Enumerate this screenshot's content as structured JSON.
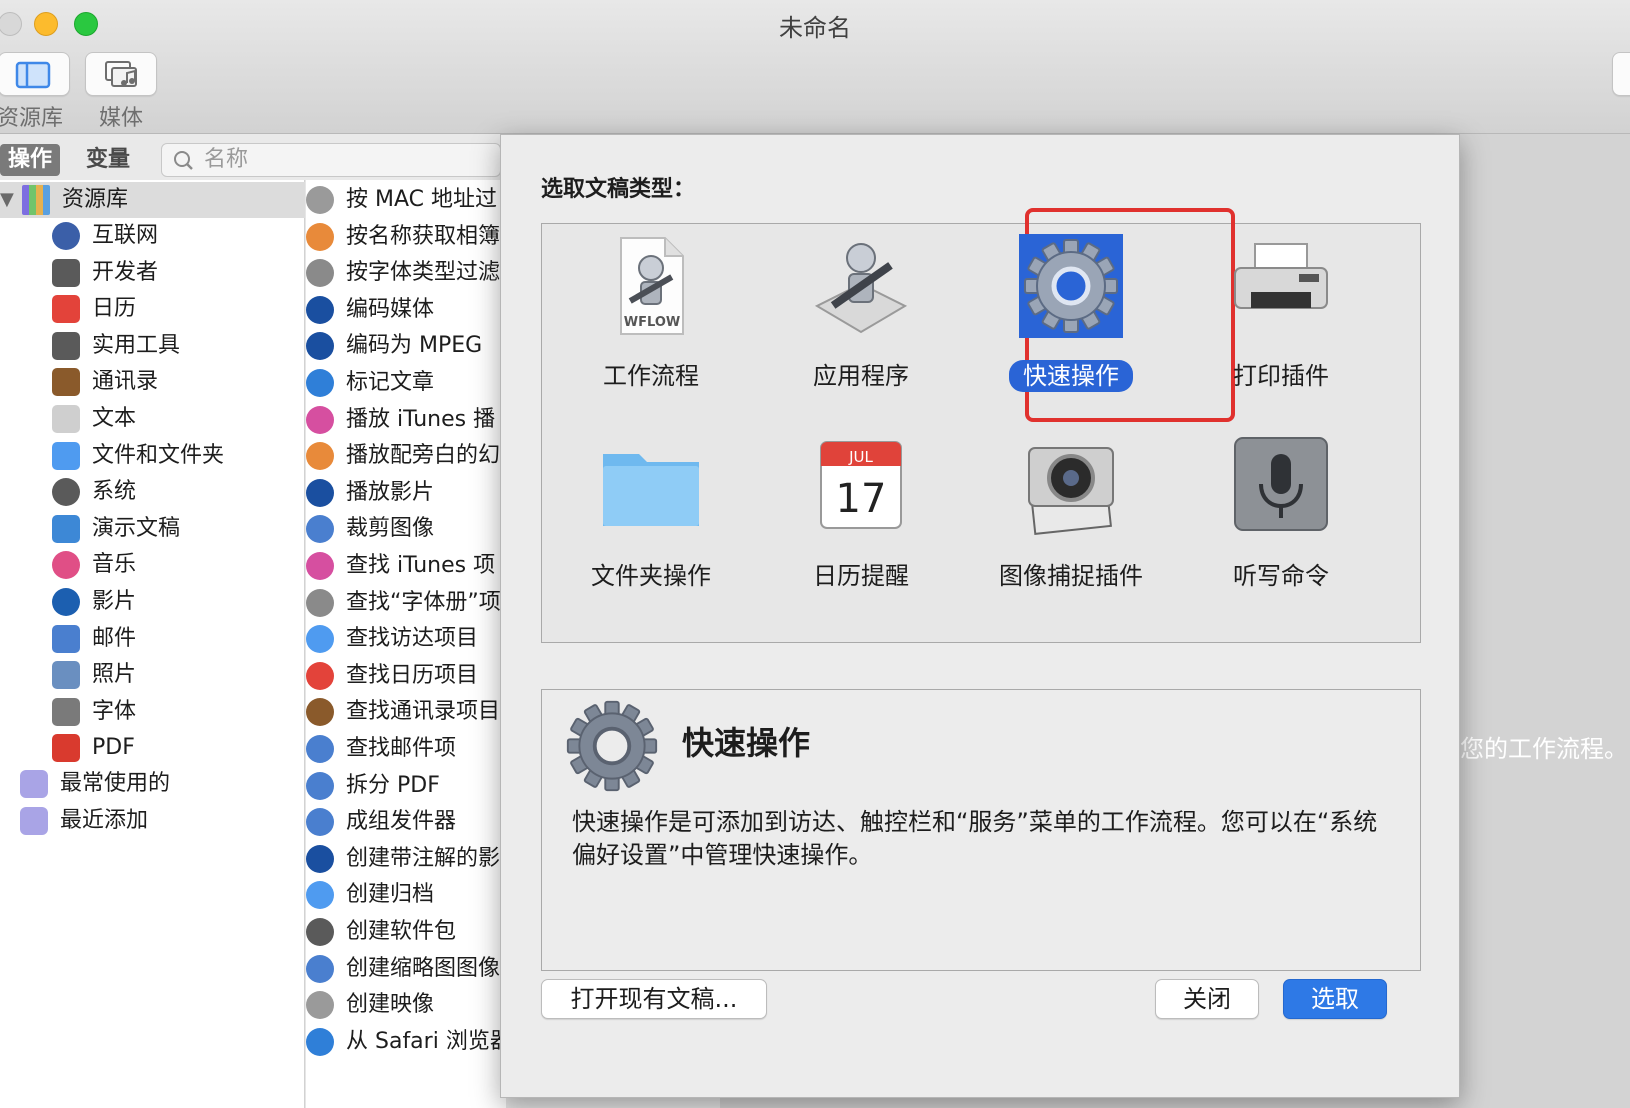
{
  "window": {
    "title": "未命名",
    "toolbar": {
      "library_label": "资源库",
      "media_label": "媒体"
    }
  },
  "sidebar": {
    "tabs": {
      "actions": "操作",
      "variables": "变量"
    },
    "search_placeholder": "名称",
    "library_root": "资源库",
    "library_items": [
      "互联网",
      "开发者",
      "日历",
      "实用工具",
      "通讯录",
      "文本",
      "文件和文件夹",
      "系统",
      "演示文稿",
      "音乐",
      "影片",
      "邮件",
      "照片",
      "字体",
      "PDF"
    ],
    "smart_groups": [
      "最常使用的",
      "最近添加"
    ]
  },
  "actions_list": [
    "按 MAC 地址过",
    "按名称获取相簿",
    "按字体类型过滤",
    "编码媒体",
    "编码为 MPEG",
    "标记文章",
    "播放 iTunes 播",
    "播放配旁白的幻",
    "播放影片",
    "裁剪图像",
    "查找 iTunes 项",
    "查找“字体册”项",
    "查找访达项目",
    "查找日历项目",
    "查找通讯录项目",
    "查找邮件项",
    "拆分 PDF",
    "成组发件器",
    "创建带注解的影",
    "创建归档",
    "创建软件包",
    "创建缩略图图像",
    "创建映像",
    "从 Safari 浏览器"
  ],
  "workflow_hint": "您的工作流程。",
  "sheet": {
    "title": "选取文稿类型：",
    "types": [
      {
        "label": "工作流程",
        "icon": "workflow-icon",
        "badge": "WFLOW"
      },
      {
        "label": "应用程序",
        "icon": "application-icon"
      },
      {
        "label": "快速操作",
        "icon": "gear-icon",
        "selected": true
      },
      {
        "label": "打印插件",
        "icon": "printer-icon"
      },
      {
        "label": "文件夹操作",
        "icon": "folder-icon"
      },
      {
        "label": "日历提醒",
        "icon": "calendar-icon",
        "month": "JUL",
        "day": "17"
      },
      {
        "label": "图像捕捉插件",
        "icon": "camera-icon"
      },
      {
        "label": "听写命令",
        "icon": "microphone-icon"
      }
    ],
    "description": {
      "title": "快速操作",
      "text": "快速操作是可添加到访达、触控栏和“服务”菜单的工作流程。您可以在“系统偏好设置”中管理快速操作。"
    },
    "buttons": {
      "open_existing": "打开现有文稿...",
      "close": "关闭",
      "choose": "选取"
    }
  },
  "colors": {
    "accent": "#2e79e6",
    "highlight_box": "#e0312e",
    "selected_tile": "#2a64d6"
  }
}
